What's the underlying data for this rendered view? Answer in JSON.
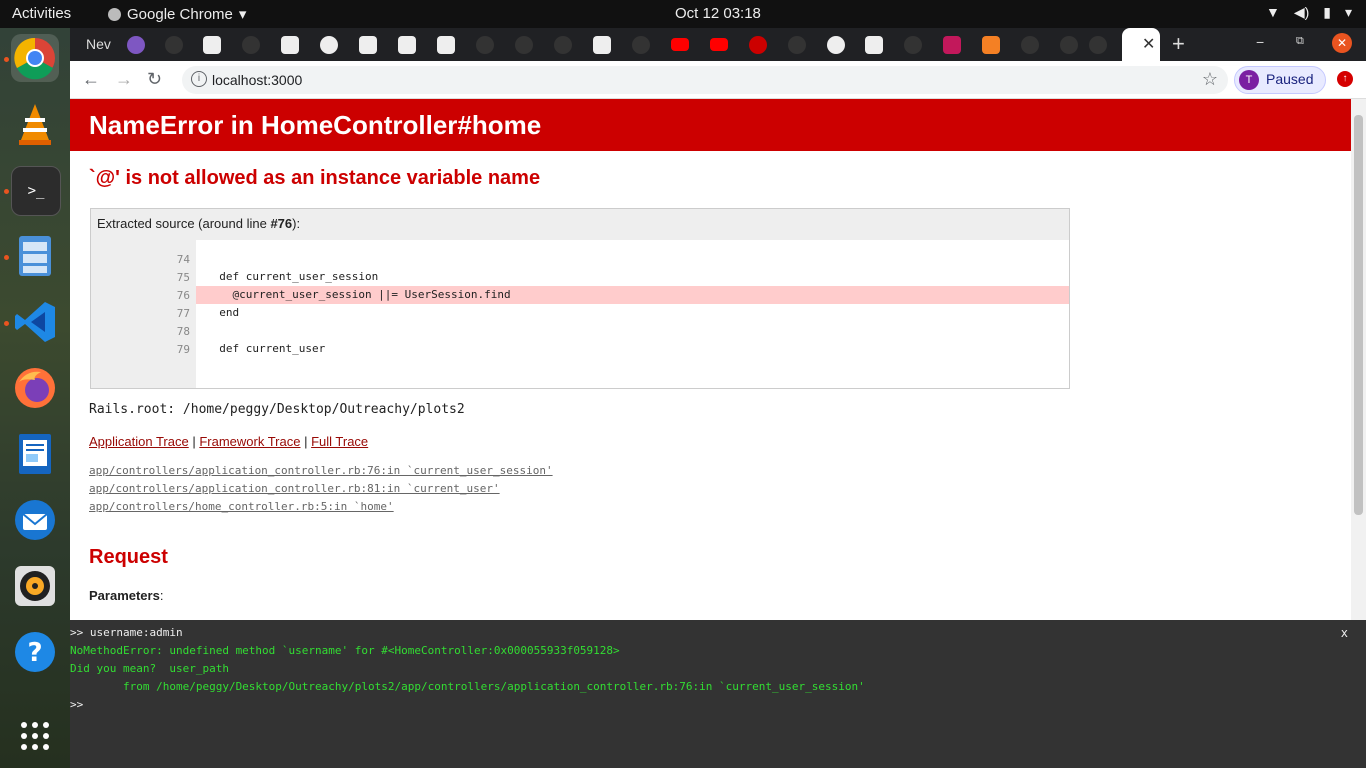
{
  "topbar": {
    "activities": "Activities",
    "app_name": "Google Chrome",
    "clock": "Oct 12  03:18"
  },
  "browser": {
    "first_tab_label": "Nev",
    "url": "localhost:3000",
    "profile_initial": "T",
    "profile_status": "Paused"
  },
  "error": {
    "title": "NameError in HomeController#home",
    "message": "`@' is not allowed as an instance variable name",
    "source_caption_prefix": "Extracted source (around line ",
    "source_caption_line": "#76",
    "source_caption_suffix": "):",
    "source_lines": [
      {
        "num": "74",
        "code": ""
      },
      {
        "num": "75",
        "code": "  def current_user_session"
      },
      {
        "num": "76",
        "code": "    @current_user_session ||= UserSession.find"
      },
      {
        "num": "77",
        "code": "  end"
      },
      {
        "num": "78",
        "code": ""
      },
      {
        "num": "79",
        "code": "  def current_user"
      }
    ],
    "rails_root": "Rails.root: /home/peggy/Desktop/Outreachy/plots2",
    "trace_links": {
      "application": "Application Trace",
      "framework": "Framework Trace",
      "full": "Full Trace",
      "separator": " | "
    },
    "trace_lines": [
      "app/controllers/application_controller.rb:76:in `current_user_session'",
      "app/controllers/application_controller.rb:81:in `current_user'",
      "app/controllers/home_controller.rb:5:in `home'"
    ],
    "request_heading": "Request",
    "params_label": "Parameters",
    "params_colon": ":"
  },
  "console": {
    "close": "x",
    "lines": [
      {
        "text": ">> username:admin",
        "color": "#eeeeee"
      },
      {
        "text": "NoMethodError: undefined method `username' for #<HomeController:0x000055933f059128>",
        "color": "#33dd33"
      },
      {
        "text": "Did you mean?  user_path",
        "color": "#33dd33"
      },
      {
        "text": "        from /home/peggy/Desktop/Outreachy/plots2/app/controllers/application_controller.rb:76:in `current_user_session'",
        "color": "#33dd33"
      },
      {
        "text": ">>",
        "color": "#eeeeee"
      }
    ]
  },
  "colors": {
    "error_red": "#cc0000",
    "highlight": "#ffcccc",
    "console_bg": "#333333"
  }
}
